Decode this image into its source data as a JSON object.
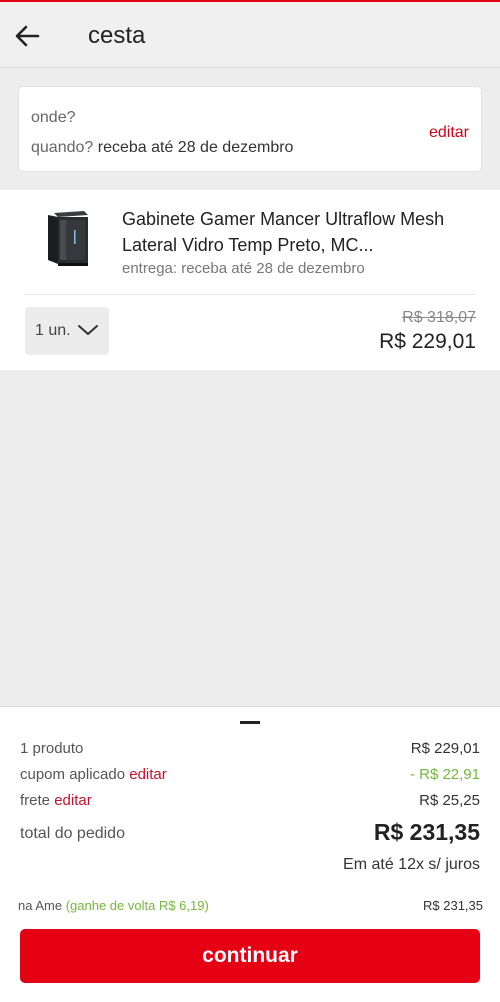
{
  "header": {
    "title": "cesta"
  },
  "delivery": {
    "where_label": "onde?",
    "when_label": "quando?",
    "when_value": "receba até 28 de dezembro",
    "edit_label": "editar"
  },
  "product": {
    "name": "Gabinete Gamer Mancer Ultraflow Mesh Lateral Vidro Temp Preto, MC...",
    "delivery": "entrega: receba até 28 de dezembro",
    "quantity": "1 un.",
    "old_price": "R$ 318,07",
    "price": "R$ 229,01"
  },
  "summary": {
    "products_label": "1 produto",
    "products_value": "R$ 229,01",
    "coupon_label": "cupom aplicado",
    "coupon_edit": "editar",
    "coupon_value": "- R$ 22,91",
    "shipping_label": "frete",
    "shipping_edit": "editar",
    "shipping_value": "R$ 25,25",
    "total_label": "total do pedido",
    "total_value": "R$ 231,35",
    "installments": "Em até 12x s/ juros",
    "ame_label": "na Ame",
    "ame_cashback": "(ganhe de volta R$ 6,19)",
    "ame_value": "R$ 231,35",
    "continue_label": "continuar"
  },
  "colors": {
    "accent": "#e60014",
    "link": "#c8102e",
    "discount": "#74b83c"
  },
  "icons": [
    "back-arrow-icon",
    "chevron-down-icon"
  ]
}
